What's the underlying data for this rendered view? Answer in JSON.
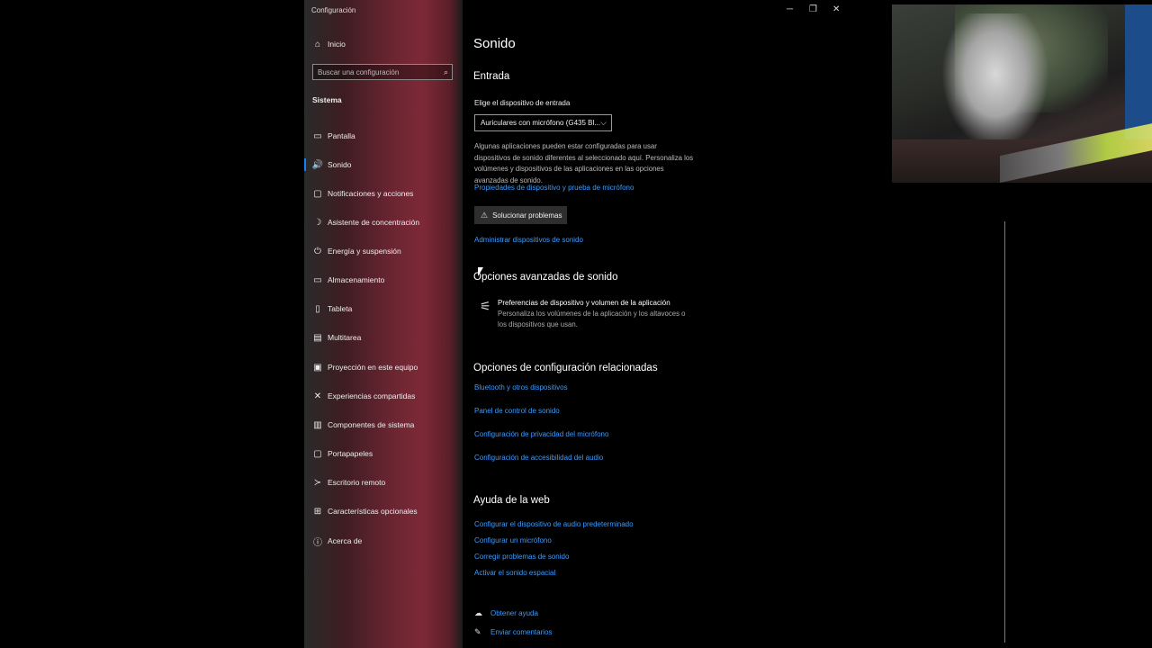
{
  "window": {
    "title": "Configuración",
    "controls": {
      "minimize": "─",
      "restore": "❐",
      "close": "✕"
    }
  },
  "sidebar": {
    "home_label": "Inicio",
    "search_placeholder": "Buscar una configuración",
    "section": "Sistema",
    "items": [
      {
        "label": "Pantalla",
        "icon": "monitor-icon",
        "glyph": "▭"
      },
      {
        "label": "Sonido",
        "icon": "speaker-icon",
        "glyph": "🔊",
        "active": true
      },
      {
        "label": "Notificaciones y acciones",
        "icon": "notification-icon",
        "glyph": "▢"
      },
      {
        "label": "Asistente de concentración",
        "icon": "moon-icon",
        "glyph": "☽"
      },
      {
        "label": "Energía y suspensión",
        "icon": "power-icon",
        "glyph": "⏻"
      },
      {
        "label": "Almacenamiento",
        "icon": "storage-icon",
        "glyph": "▭"
      },
      {
        "label": "Tableta",
        "icon": "tablet-icon",
        "glyph": "▯"
      },
      {
        "label": "Multitarea",
        "icon": "multitask-icon",
        "glyph": "▤"
      },
      {
        "label": "Proyección en este equipo",
        "icon": "projection-icon",
        "glyph": "▣"
      },
      {
        "label": "Experiencias compartidas",
        "icon": "shared-icon",
        "glyph": "✕"
      },
      {
        "label": "Componentes de sistema",
        "icon": "components-icon",
        "glyph": "▥"
      },
      {
        "label": "Portapapeles",
        "icon": "clipboard-icon",
        "glyph": "▢"
      },
      {
        "label": "Escritorio remoto",
        "icon": "remote-icon",
        "glyph": "≻"
      },
      {
        "label": "Características opcionales",
        "icon": "features-icon",
        "glyph": "⊞"
      },
      {
        "label": "Acerca de",
        "icon": "info-icon",
        "glyph": "ⓘ"
      }
    ]
  },
  "content": {
    "title": "Sonido",
    "input_heading": "Entrada",
    "input_device_label": "Elige el dispositivo de entrada",
    "input_device_value": "Auriculares con micrófono (G435 Bl...",
    "input_description": "Algunas aplicaciones pueden estar configuradas para usar dispositivos de sonido diferentes al seleccionado aquí. Personaliza los volúmenes y dispositivos de las aplicaciones en las opciones avanzadas de sonido.",
    "device_properties_link": "Propiedades de dispositivo y prueba de micrófono",
    "troubleshoot_button": "Solucionar problemas",
    "manage_devices_link": "Administrar dispositivos de sonido",
    "advanced_heading": "Opciones avanzadas de sonido",
    "advanced_item_title": "Preferencias de dispositivo y volumen de la aplicación",
    "advanced_item_desc": "Personaliza los volúmenes de la aplicación y los altavoces o los dispositivos que usan.",
    "related_heading": "Opciones de configuración relacionadas",
    "related_links": [
      "Bluetooth y otros dispositivos",
      "Panel de control de sonido",
      "Configuración de privacidad del micrófono",
      "Configuración de accesibilidad del audio"
    ],
    "web_help_heading": "Ayuda de la web",
    "web_help_links": [
      "Configurar el dispositivo de audio predeterminado",
      "Configurar un micrófono",
      "Corregir problemas de sonido",
      "Activar el sonido espacial"
    ],
    "get_help": "Obtener ayuda",
    "send_feedback": "Enviar comentarios"
  },
  "colors": {
    "accent": "#0a84ff",
    "link": "#3b9cff"
  }
}
